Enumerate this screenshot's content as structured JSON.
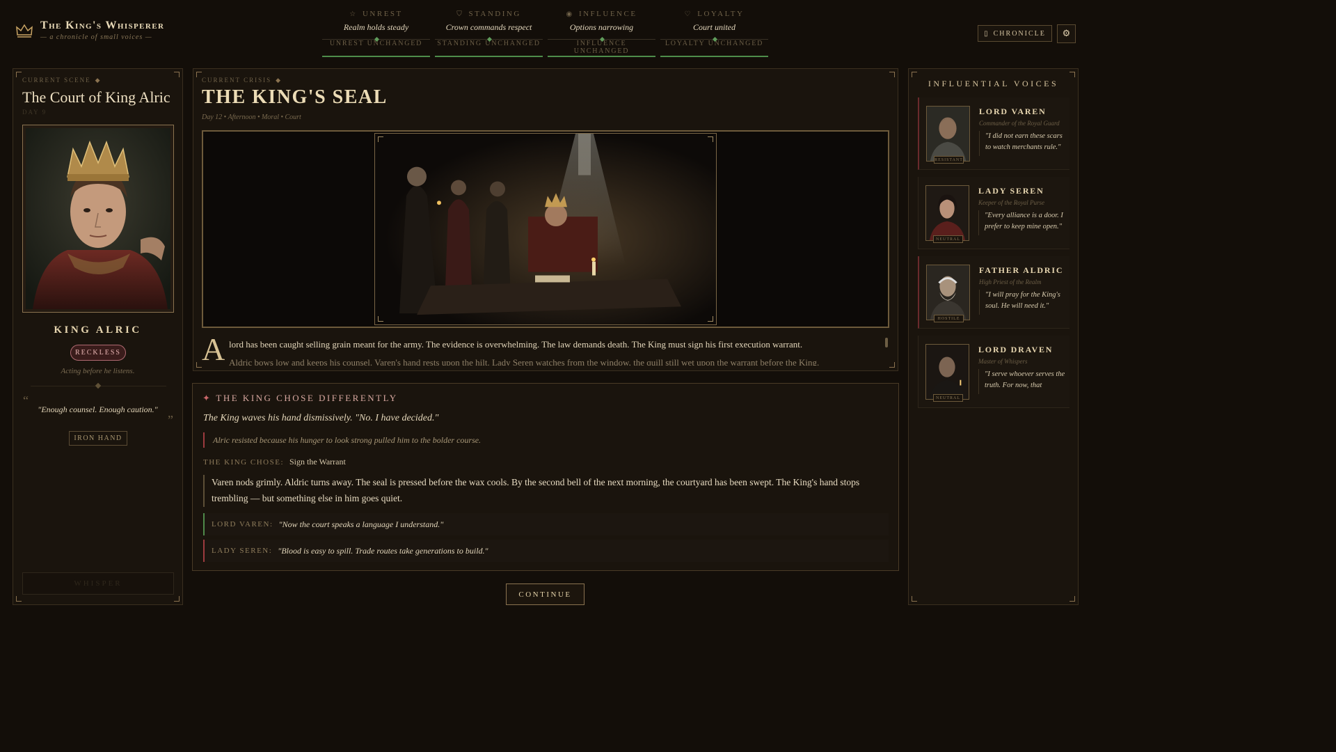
{
  "header": {
    "title": "The King's Whisperer",
    "subtitle": "— a chronicle of small voices —",
    "stats": [
      {
        "icon": "star-icon",
        "glyph": "☆",
        "name": "Unrest",
        "value": "Realm holds steady",
        "change": "Unrest unchanged"
      },
      {
        "icon": "shield-icon",
        "glyph": "⛉",
        "name": "Standing",
        "value": "Crown commands respect",
        "change": "Standing unchanged"
      },
      {
        "icon": "eye-icon",
        "glyph": "◉",
        "name": "Influence",
        "value": "Options narrowing",
        "change": "Influence unchanged"
      },
      {
        "icon": "heart-icon",
        "glyph": "♡",
        "name": "Loyalty",
        "value": "Court united",
        "change": "Loyalty unchanged"
      }
    ],
    "chronicle_label": "CHRONICLE",
    "colors": {
      "accent_gold": "#c9a464",
      "stat_bar_green": "#4e8d4b",
      "danger_red": "#9e3b3f"
    }
  },
  "scene": {
    "kicker": "Current Scene",
    "title": "The Court of King Alric",
    "day": "DAY 9",
    "king_name": "KING ALRIC",
    "trait": "RECKLESS",
    "trait_desc": "Acting before he listens.",
    "quote": "\"Enough counsel. Enough caution.\"",
    "tag": "IRON HAND",
    "whisper_label": "WHISPER"
  },
  "crisis": {
    "kicker": "Current Crisis",
    "title": "THE KING'S SEAL",
    "meta": "Day 12  •  Afternoon • Moral • Court",
    "dropcap": "A",
    "story": "lord has been caught selling grain meant for the army. The evidence is overwhelming. The law demands death. The King must sign his first execution warrant.",
    "story_next": "Aldric bows low and keeps his counsel. Varen's hand rests upon the hilt. Lady Seren watches from the window, the quill still wet upon the warrant before the King."
  },
  "outcome": {
    "heading": "The King chose differently",
    "line1": "The King waves his hand dismissively. \"No. I have decided.\"",
    "reason": "Alric resisted because his hunger to look strong pulled him to the bolder course.",
    "chose_label": "THE KING CHOSE:",
    "chose_value": "Sign the Warrant",
    "result": "Varen nods grimly. Aldric turns away. The seal is pressed before the wax cools. By the second bell of the next morning, the courtyard has been swept. The King's hand stops trembling — but something else in him goes quiet.",
    "reactions": [
      {
        "who": "LORD VAREN:",
        "said": "\"Now the court speaks a language I understand.\""
      },
      {
        "who": "LADY SEREN:",
        "said": "\"Blood is easy to spill. Trade routes take generations to build.\""
      }
    ],
    "continue_label": "CONTINUE"
  },
  "voices": {
    "title": "Influential Voices",
    "items": [
      {
        "name": "Lord Varen",
        "role": "Commander of the Royal Guard",
        "quote": "\"I did not earn these scars to watch merchants rule.\"",
        "status": "Resistant"
      },
      {
        "name": "Lady Seren",
        "role": "Keeper of the Royal Purse",
        "quote": "\"Every alliance is a door. I prefer to keep mine open.\"",
        "status": "Neutral"
      },
      {
        "name": "Father Aldric",
        "role": "High Priest of the Realm",
        "quote": "\"I will pray for the King's soul. He will need it.\"",
        "status": "Hostile"
      },
      {
        "name": "Lord Draven",
        "role": "Master of Whispers",
        "quote": "\"I serve whoever serves the truth. For now, that appea...",
        "status": "Neutral"
      }
    ]
  }
}
